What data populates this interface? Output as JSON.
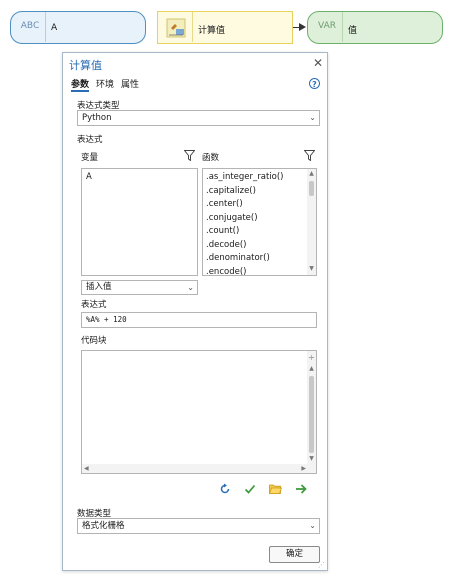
{
  "model": {
    "input_node": {
      "badge": "ABC",
      "label": "A"
    },
    "tool_node": {
      "label": "计算值"
    },
    "output_node": {
      "badge": "VAR",
      "label": "值"
    }
  },
  "dialog": {
    "title": "计算值",
    "close_glyph": "✕",
    "tabs": [
      {
        "label": "参数",
        "active": true
      },
      {
        "label": "环境",
        "active": false
      },
      {
        "label": "属性",
        "active": false
      }
    ],
    "help_glyph": "?",
    "expression_type": {
      "label": "表达式类型",
      "value": "Python"
    },
    "expression_section_label": "表达式",
    "variables": {
      "header": "变量",
      "items": [
        "A"
      ]
    },
    "functions": {
      "header": "函数",
      "items": [
        ".as_integer_ratio()",
        ".capitalize()",
        ".center()",
        ".conjugate()",
        ".count()",
        ".decode()",
        ".denominator()",
        ".encode()"
      ]
    },
    "insert_value": {
      "value": "插入值"
    },
    "expression": {
      "label": "表达式",
      "value": "%A% + 120"
    },
    "code_block": {
      "label": "代码块",
      "value": ""
    },
    "data_type": {
      "label": "数据类型",
      "value": "格式化栅格"
    },
    "ok_button": "确定",
    "colors": {
      "accent": "#2a6db5",
      "green_check": "#3a9a3a",
      "folder": "#e6b422",
      "arrow_green": "#3a9a3a"
    }
  }
}
